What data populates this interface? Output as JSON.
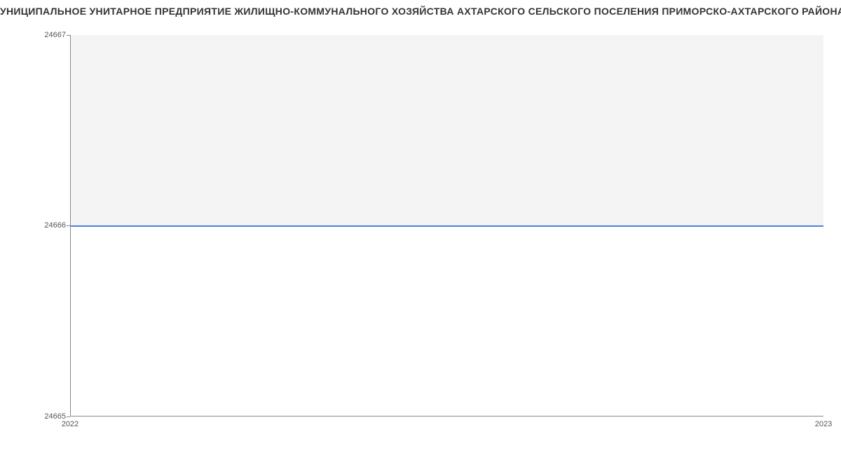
{
  "chart_data": {
    "type": "line",
    "title": "УНИЦИПАЛЬНОЕ УНИТАРНОЕ ПРЕДПРИЯТИЕ ЖИЛИЩНО-КОММУНАЛЬНОГО ХОЗЯЙСТВА АХТАРСКОГО СЕЛЬСКОГО ПОСЕЛЕНИЯ ПРИМОРСКО-АХТАРСКОГО РАЙОНА | Данны",
    "x": [
      "2022",
      "2023"
    ],
    "values": [
      24666,
      24666
    ],
    "ylim": [
      24665,
      24667
    ],
    "y_ticks": [
      24665,
      24666,
      24667
    ],
    "x_ticks": [
      "2022",
      "2023"
    ],
    "xlabel": "",
    "ylabel": ""
  },
  "labels": {
    "ytick_top": "24667",
    "ytick_mid": "24666",
    "ytick_bot": "24665",
    "xtick_left": "2022",
    "xtick_right": "2023"
  }
}
